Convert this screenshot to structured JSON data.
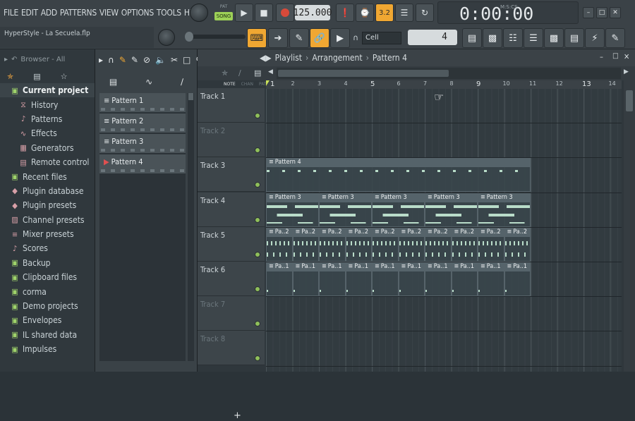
{
  "menu": [
    "FILE",
    "EDIT",
    "ADD",
    "PATTERNS",
    "VIEW",
    "OPTIONS",
    "TOOLS",
    "HELP"
  ],
  "song_title": "HyperStyle - La Secuela.flp",
  "mode_label": "SONG",
  "tempo": "125.000",
  "time_display": "0:00:00",
  "time_label": "M:S:CS",
  "snap_label": "Cell",
  "snap_value": "4",
  "browser": {
    "header": "Browser - All",
    "items": [
      {
        "label": "Current project",
        "icon": "folder-icon",
        "top": true
      },
      {
        "label": "History",
        "icon": "history-icon",
        "indent": true
      },
      {
        "label": "Patterns",
        "icon": "note-icon",
        "indent": true
      },
      {
        "label": "Effects",
        "icon": "effects-icon",
        "indent": true
      },
      {
        "label": "Generators",
        "icon": "generators-icon",
        "indent": true
      },
      {
        "label": "Remote control",
        "icon": "remote-icon",
        "indent": true
      },
      {
        "label": "Recent files",
        "icon": "folder-icon"
      },
      {
        "label": "Plugin database",
        "icon": "plugin-icon"
      },
      {
        "label": "Plugin presets",
        "icon": "plugin-icon"
      },
      {
        "label": "Channel presets",
        "icon": "channel-icon"
      },
      {
        "label": "Mixer presets",
        "icon": "mixer-icon"
      },
      {
        "label": "Scores",
        "icon": "note-icon"
      },
      {
        "label": "Backup",
        "icon": "folder-icon"
      },
      {
        "label": "Clipboard files",
        "icon": "folder-icon"
      },
      {
        "label": "corma",
        "icon": "folder-icon"
      },
      {
        "label": "Demo projects",
        "icon": "folder-icon"
      },
      {
        "label": "Envelopes",
        "icon": "folder-icon"
      },
      {
        "label": "IL shared data",
        "icon": "folder-icon"
      },
      {
        "label": "Impulses",
        "icon": "folder-icon"
      }
    ]
  },
  "patterns": [
    "Pattern 1",
    "Pattern 2",
    "Pattern 3",
    "Pattern 4"
  ],
  "playlist": {
    "title": "Playlist",
    "crumbs": [
      "Arrangement",
      "Pattern 4"
    ],
    "sub_labels": [
      "NOTE",
      "CHAN",
      "PAT"
    ],
    "ruler": [
      "1",
      "2",
      "3",
      "4",
      "5",
      "6",
      "7",
      "8",
      "9",
      "10",
      "11",
      "12",
      "13",
      "14"
    ],
    "tracks": [
      {
        "label": "Track 1",
        "dim": false
      },
      {
        "label": "Track 2",
        "dim": true
      },
      {
        "label": "Track 3",
        "dim": false
      },
      {
        "label": "Track 4",
        "dim": false
      },
      {
        "label": "Track 5",
        "dim": false
      },
      {
        "label": "Track 6",
        "dim": false
      },
      {
        "label": "Track 7",
        "dim": true
      },
      {
        "label": "Track 8",
        "dim": true
      }
    ],
    "clips": [
      {
        "row": 2,
        "start": 0,
        "length": 10,
        "label": "Pattern 4",
        "style": "sparse"
      },
      {
        "row": 3,
        "start": 0,
        "length": 2,
        "label": "Pattern 3",
        "style": "pat3"
      },
      {
        "row": 3,
        "start": 2,
        "length": 2,
        "label": "Pattern 3",
        "style": "pat3"
      },
      {
        "row": 3,
        "start": 4,
        "length": 2,
        "label": "Pattern 3",
        "style": "pat3"
      },
      {
        "row": 3,
        "start": 6,
        "length": 2,
        "label": "Pattern 3",
        "style": "pat3"
      },
      {
        "row": 3,
        "start": 8,
        "length": 2,
        "label": "Pattern 3",
        "style": "pat3"
      },
      {
        "row": 4,
        "start": 0,
        "length": 1,
        "label": "Pa..2",
        "style": "dense"
      },
      {
        "row": 4,
        "start": 1,
        "length": 1,
        "label": "Pa..2",
        "style": "dense"
      },
      {
        "row": 4,
        "start": 2,
        "length": 1,
        "label": "Pa..2",
        "style": "dense"
      },
      {
        "row": 4,
        "start": 3,
        "length": 1,
        "label": "Pa..2",
        "style": "dense"
      },
      {
        "row": 4,
        "start": 4,
        "length": 1,
        "label": "Pa..2",
        "style": "dense"
      },
      {
        "row": 4,
        "start": 5,
        "length": 1,
        "label": "Pa..2",
        "style": "dense"
      },
      {
        "row": 4,
        "start": 6,
        "length": 1,
        "label": "Pa..2",
        "style": "dense"
      },
      {
        "row": 4,
        "start": 7,
        "length": 1,
        "label": "Pa..2",
        "style": "dense"
      },
      {
        "row": 4,
        "start": 8,
        "length": 1,
        "label": "Pa..2",
        "style": "dense"
      },
      {
        "row": 4,
        "start": 9,
        "length": 1,
        "label": "Pa..2",
        "style": "dense"
      },
      {
        "row": 5,
        "start": 0,
        "length": 1,
        "label": "Pa..1",
        "style": "line"
      },
      {
        "row": 5,
        "start": 1,
        "length": 1,
        "label": "Pa..1",
        "style": "line"
      },
      {
        "row": 5,
        "start": 2,
        "length": 1,
        "label": "Pa..1",
        "style": "line"
      },
      {
        "row": 5,
        "start": 3,
        "length": 1,
        "label": "Pa..1",
        "style": "line"
      },
      {
        "row": 5,
        "start": 4,
        "length": 1,
        "label": "Pa..1",
        "style": "line"
      },
      {
        "row": 5,
        "start": 5,
        "length": 1,
        "label": "Pa..1",
        "style": "line"
      },
      {
        "row": 5,
        "start": 6,
        "length": 1,
        "label": "Pa..1",
        "style": "line"
      },
      {
        "row": 5,
        "start": 7,
        "length": 1,
        "label": "Pa..1",
        "style": "line"
      },
      {
        "row": 5,
        "start": 8,
        "length": 1,
        "label": "Pa..1",
        "style": "line"
      },
      {
        "row": 5,
        "start": 9,
        "length": 1,
        "label": "Pa..1",
        "style": "line"
      }
    ]
  },
  "colors": {
    "accent": "#f0a732",
    "clip_note": "#b9dcc9",
    "led": "#8fbf5a",
    "record": "#d84a3a"
  }
}
